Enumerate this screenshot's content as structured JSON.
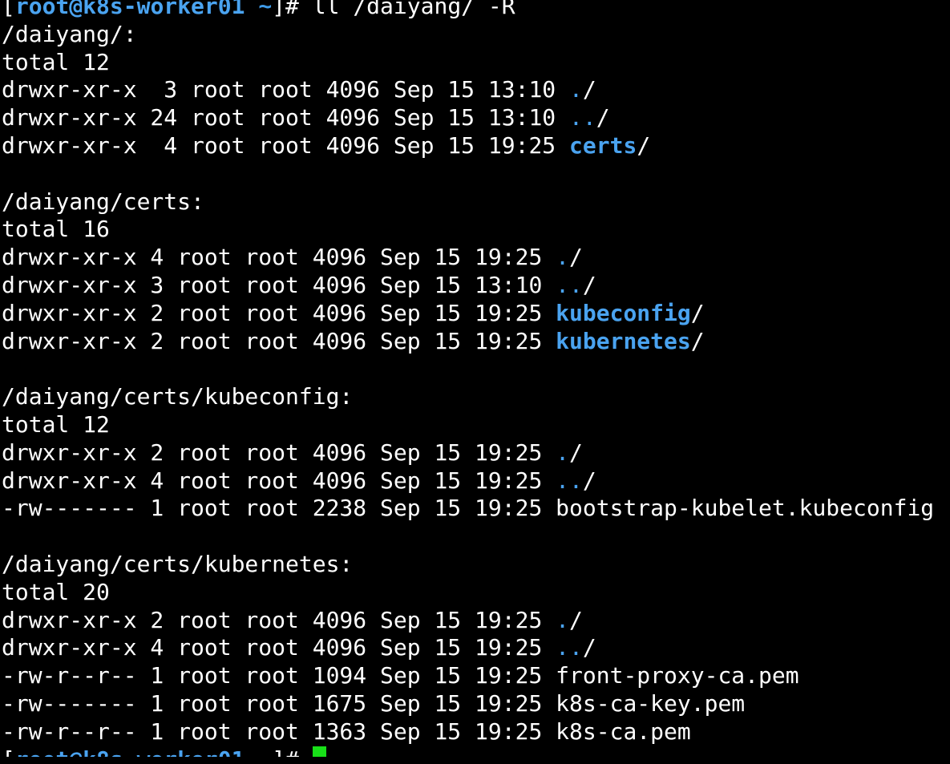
{
  "prompt": {
    "user": "root",
    "host": "k8s-worker01",
    "cwd": "~"
  },
  "command": "ll /daiyang/ -R",
  "sections": [
    {
      "header": "/daiyang/:",
      "total": "total 12",
      "entries": [
        {
          "meta": "drwxr-xr-x  3 root root 4096 Sep 15 13:10 ",
          "name": "./",
          "kind": "dots"
        },
        {
          "meta": "drwxr-xr-x 24 root root 4096 Sep 15 13:10 ",
          "name": "../",
          "kind": "dots"
        },
        {
          "meta": "drwxr-xr-x  4 root root 4096 Sep 15 19:25 ",
          "name": "certs",
          "kind": "dir"
        }
      ]
    },
    {
      "header": "/daiyang/certs:",
      "total": "total 16",
      "entries": [
        {
          "meta": "drwxr-xr-x 4 root root 4096 Sep 15 19:25 ",
          "name": "./",
          "kind": "dots"
        },
        {
          "meta": "drwxr-xr-x 3 root root 4096 Sep 15 13:10 ",
          "name": "../",
          "kind": "dots"
        },
        {
          "meta": "drwxr-xr-x 2 root root 4096 Sep 15 19:25 ",
          "name": "kubeconfig",
          "kind": "dir"
        },
        {
          "meta": "drwxr-xr-x 2 root root 4096 Sep 15 19:25 ",
          "name": "kubernetes",
          "kind": "dir"
        }
      ]
    },
    {
      "header": "/daiyang/certs/kubeconfig:",
      "total": "total 12",
      "entries": [
        {
          "meta": "drwxr-xr-x 2 root root 4096 Sep 15 19:25 ",
          "name": "./",
          "kind": "dots"
        },
        {
          "meta": "drwxr-xr-x 4 root root 4096 Sep 15 19:25 ",
          "name": "../",
          "kind": "dots"
        },
        {
          "meta": "-rw------- 1 root root 2238 Sep 15 19:25 ",
          "name": "bootstrap-kubelet.kubeconfig",
          "kind": "file"
        }
      ]
    },
    {
      "header": "/daiyang/certs/kubernetes:",
      "total": "total 20",
      "entries": [
        {
          "meta": "drwxr-xr-x 2 root root 4096 Sep 15 19:25 ",
          "name": "./",
          "kind": "dots"
        },
        {
          "meta": "drwxr-xr-x 4 root root 4096 Sep 15 19:25 ",
          "name": "../",
          "kind": "dots"
        },
        {
          "meta": "-rw-r--r-- 1 root root 1094 Sep 15 19:25 ",
          "name": "front-proxy-ca.pem",
          "kind": "file"
        },
        {
          "meta": "-rw------- 1 root root 1675 Sep 15 19:25 ",
          "name": "k8s-ca-key.pem",
          "kind": "file"
        },
        {
          "meta": "-rw-r--r-- 1 root root 1363 Sep 15 19:25 ",
          "name": "k8s-ca.pem",
          "kind": "file"
        }
      ]
    }
  ],
  "colors": {
    "background": "#000000",
    "foreground": "#ffffff",
    "directory": "#4aa3f0",
    "cursor": "#18e018"
  }
}
